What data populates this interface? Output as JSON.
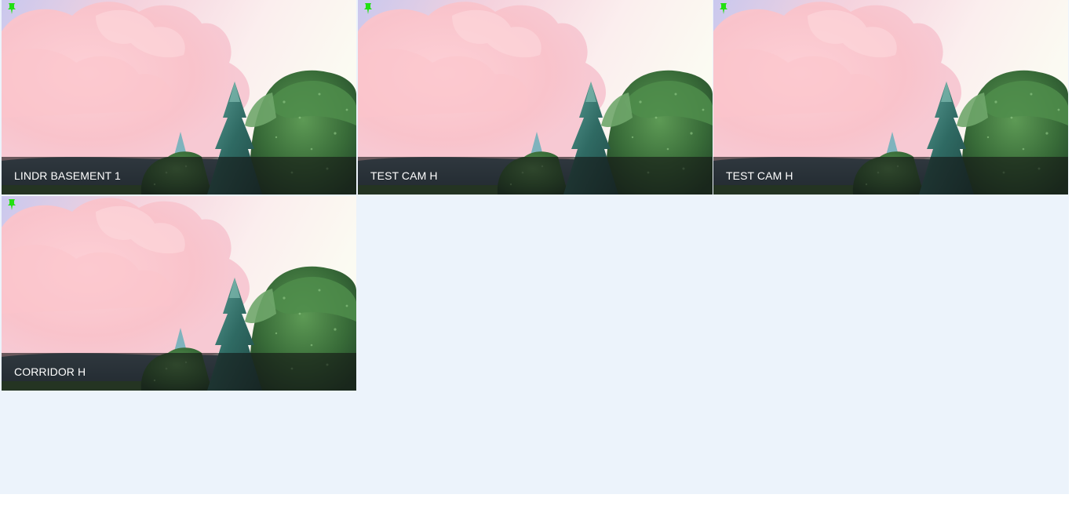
{
  "camera_grid": {
    "tiles": [
      {
        "label": "LINDR BASEMENT 1",
        "pin_icon": "pin-icon",
        "pin_color": "#22e012"
      },
      {
        "label": "TEST CAM H",
        "pin_icon": "pin-icon",
        "pin_color": "#22e012"
      },
      {
        "label": "TEST CAM H",
        "pin_icon": "pin-icon",
        "pin_color": "#22e012"
      },
      {
        "label": "CORRIDOR H",
        "pin_icon": "pin-icon",
        "pin_color": "#22e012"
      }
    ]
  },
  "colors": {
    "background": "#ecf3fb",
    "caption_overlay": "rgba(20,20,20,0.62)",
    "caption_text": "#ffffff"
  }
}
